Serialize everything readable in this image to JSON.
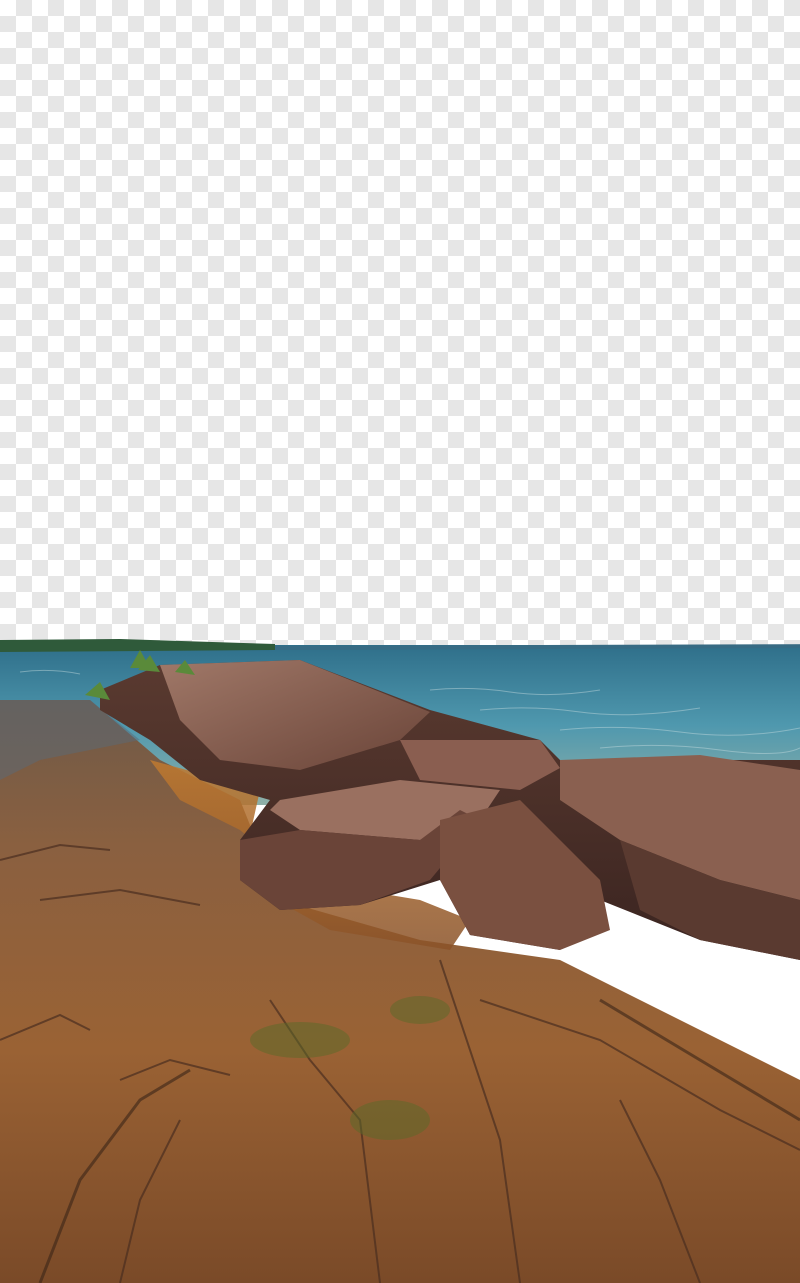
{
  "image": {
    "colors": {
      "transparent_checker_light": "#ffffff",
      "transparent_checker_dark": "#e6e6e6",
      "lake_blue": "#3f8fa8",
      "lake_deep": "#2f6f8a",
      "distant_shore": "#2f5a3a",
      "shallow_water_brown": "#8a5a30",
      "rock_dark": "#4a3028",
      "rock_mid": "#7a5244",
      "rock_light": "#a07868",
      "algae_green": "#5a6a2a"
    }
  }
}
